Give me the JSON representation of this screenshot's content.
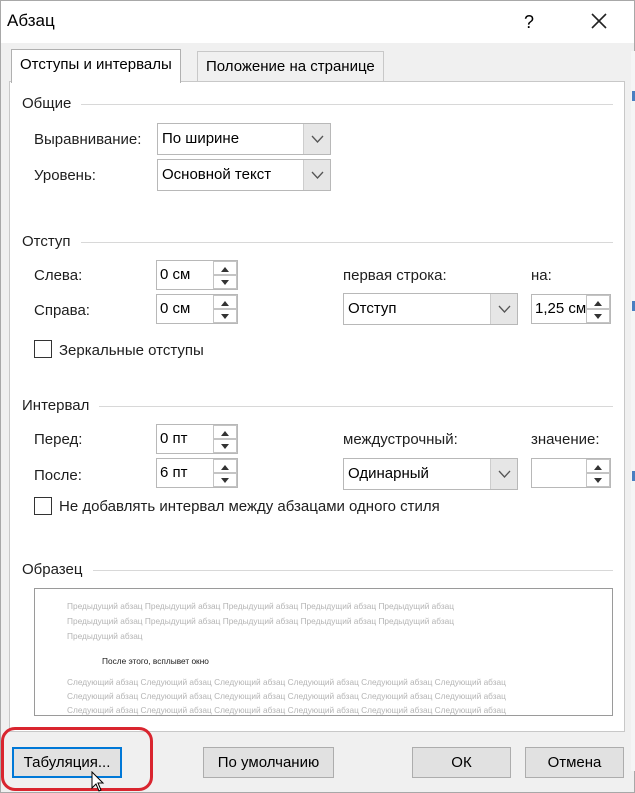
{
  "dialog": {
    "title": "Абзац",
    "help_label": "?",
    "accent_color": "#0078d7",
    "highlight_color": "#d9252f"
  },
  "tabs": [
    {
      "label": "Отступы и интервалы",
      "active": true
    },
    {
      "label": "Положение на странице",
      "active": false
    }
  ],
  "general": {
    "title": "Общие",
    "alignment_label": "Выравнивание:",
    "alignment_value": "По ширине",
    "level_label": "Уровень:",
    "level_value": "Основной текст"
  },
  "indent": {
    "title": "Отступ",
    "left_label": "Слева:",
    "left_value": "0 см",
    "right_label": "Справа:",
    "right_value": "0 см",
    "first_line_label": "первая строка:",
    "first_line_value": "Отступ",
    "by_label": "на:",
    "by_value": "1,25 см",
    "mirror_label": "Зеркальные отступы",
    "mirror_checked": false
  },
  "spacing": {
    "title": "Интервал",
    "before_label": "Перед:",
    "before_value": "0 пт",
    "after_label": "После:",
    "after_value": "6 пт",
    "line_spacing_label": "междустрочный:",
    "line_spacing_value": "Одинарный",
    "at_label": "значение:",
    "at_value": "",
    "dont_add_label": "Не добавлять интервал между абзацами одного стиля",
    "dont_add_checked": false
  },
  "preview": {
    "title": "Образец",
    "prev_line_1": "Предыдущий абзац Предыдущий абзац Предыдущий абзац Предыдущий абзац Предыдущий абзац",
    "prev_line_2": "Предыдущий абзац Предыдущий абзац Предыдущий абзац Предыдущий абзац Предыдущий абзац",
    "prev_line_3": "Предыдущий абзац",
    "current_text": "После этого, всплывет окно",
    "next_line_1": "Следующий абзац Следующий абзац Следующий абзац Следующий абзац Следующий абзац Следующий абзац",
    "next_line_2": "Следующий абзац Следующий абзац Следующий абзац Следующий абзац Следующий абзац Следующий абзац",
    "next_line_3": "Следующий абзац Следующий абзац Следующий абзац Следующий абзац Следующий абзац Следующий абзац"
  },
  "buttons": {
    "tabs_label": "Табуляция...",
    "default_label": "По умолчанию",
    "ok_label": "ОК",
    "cancel_label": "Отмена"
  }
}
